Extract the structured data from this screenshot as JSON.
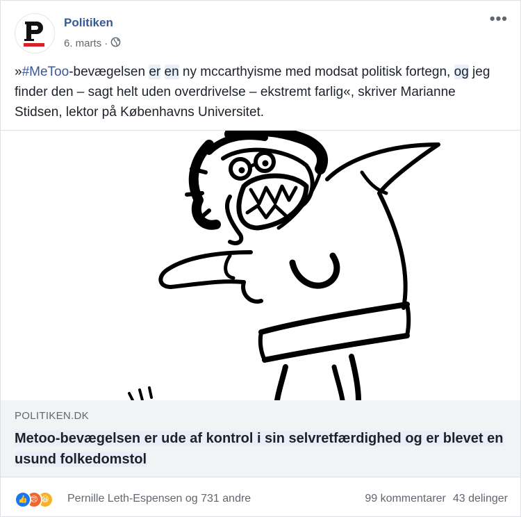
{
  "post": {
    "page_name": "Politiken",
    "date": "6. marts",
    "separator": "·",
    "visibility_icon": "globe-icon",
    "more_icon": "more-options-icon",
    "text": {
      "open_quote": "»",
      "hashtag": "#MeToo",
      "part1": "-bevægelsen ",
      "w_er": "er",
      "sp1": " ",
      "w_en": "en",
      "part2": " ny mccarthyisme med modsat politisk fortegn, ",
      "w_og": "og",
      "part3": " jeg finder den – sagt helt uden overdrivelse – ekstremt farlig«, skriver Marianne Stidsen, lektor på Københavns Universitet."
    }
  },
  "link_preview": {
    "domain": "POLITIKEN.DK",
    "title": "Metoo-bevægelsen er ude af kontrol i sin selvretfærdighed og er blevet en usund folkedomstol"
  },
  "footer": {
    "reactions": [
      "like-icon",
      "angry-icon",
      "haha-icon"
    ],
    "reaction_text": "Pernille Leth-Espensen og 731 andre",
    "comments": "99 kommentarer",
    "shares": "43 delinger"
  },
  "colors": {
    "link_blue": "#385898",
    "like_blue": "#1877f2",
    "angry_orange": "#f0662f",
    "haha_yellow": "#f7b125"
  }
}
